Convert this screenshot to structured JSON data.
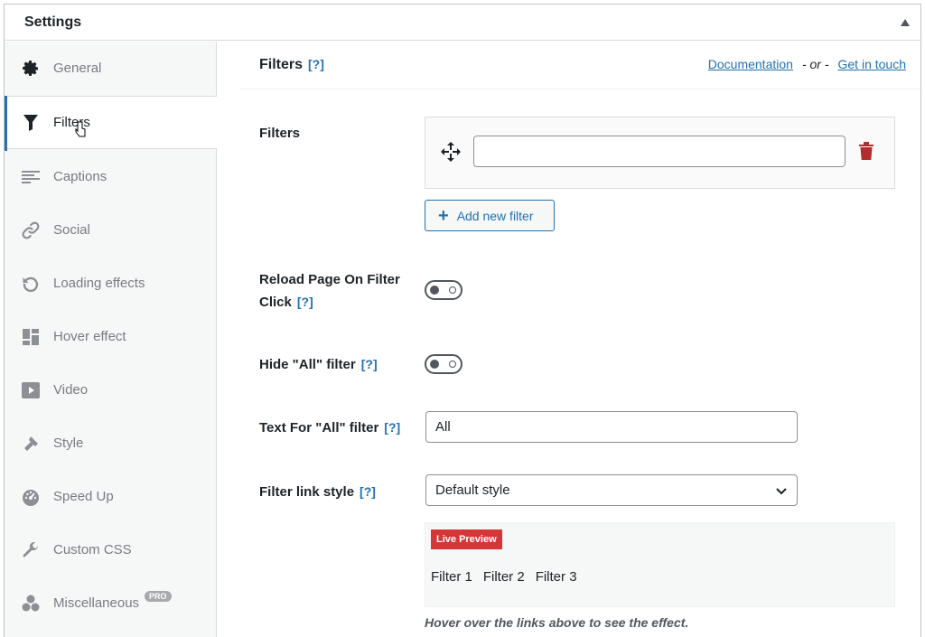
{
  "header": {
    "title": "Settings",
    "toggle_icon": "triangle-up-icon"
  },
  "sidebar": {
    "items": [
      {
        "label": "General",
        "icon": "gear-icon"
      },
      {
        "label": "Filters",
        "icon": "funnel-icon",
        "active": true
      },
      {
        "label": "Captions",
        "icon": "text-align-icon"
      },
      {
        "label": "Social",
        "icon": "link-icon"
      },
      {
        "label": "Loading effects",
        "icon": "reload-icon"
      },
      {
        "label": "Hover effect",
        "icon": "layout-grid-icon"
      },
      {
        "label": "Video",
        "icon": "play-icon"
      },
      {
        "label": "Style",
        "icon": "brush-icon"
      },
      {
        "label": "Speed Up",
        "icon": "dashboard-icon"
      },
      {
        "label": "Custom CSS",
        "icon": "wrench-icon"
      },
      {
        "label": "Miscellaneous",
        "icon": "dots-group-icon",
        "badge": "PRO"
      }
    ]
  },
  "main": {
    "title": "Filters",
    "help": "[?]",
    "links": {
      "documentation": "Documentation",
      "or": "- or -",
      "contact": "Get in touch"
    },
    "filters": {
      "label": "Filters",
      "input_value": "",
      "add_button": "Add new filter"
    },
    "reload": {
      "label_line1": "Reload Page On Filter",
      "label_line2": "Click",
      "help": "[?]",
      "enabled": false
    },
    "hide_all": {
      "label": "Hide \"All\" filter",
      "help": "[?]",
      "enabled": false
    },
    "text_all": {
      "label": "Text For \"All\" filter",
      "help": "[?]",
      "value": "All"
    },
    "link_style": {
      "label": "Filter link style",
      "help": "[?]",
      "selected": "Default style"
    },
    "preview": {
      "badge": "Live Preview",
      "links": [
        "Filter 1",
        "Filter 2",
        "Filter 3"
      ],
      "hint": "Hover over the links above to see the effect."
    }
  },
  "colors": {
    "accent": "#2271b1",
    "danger": "#d63638",
    "trash": "#b32d2e"
  }
}
